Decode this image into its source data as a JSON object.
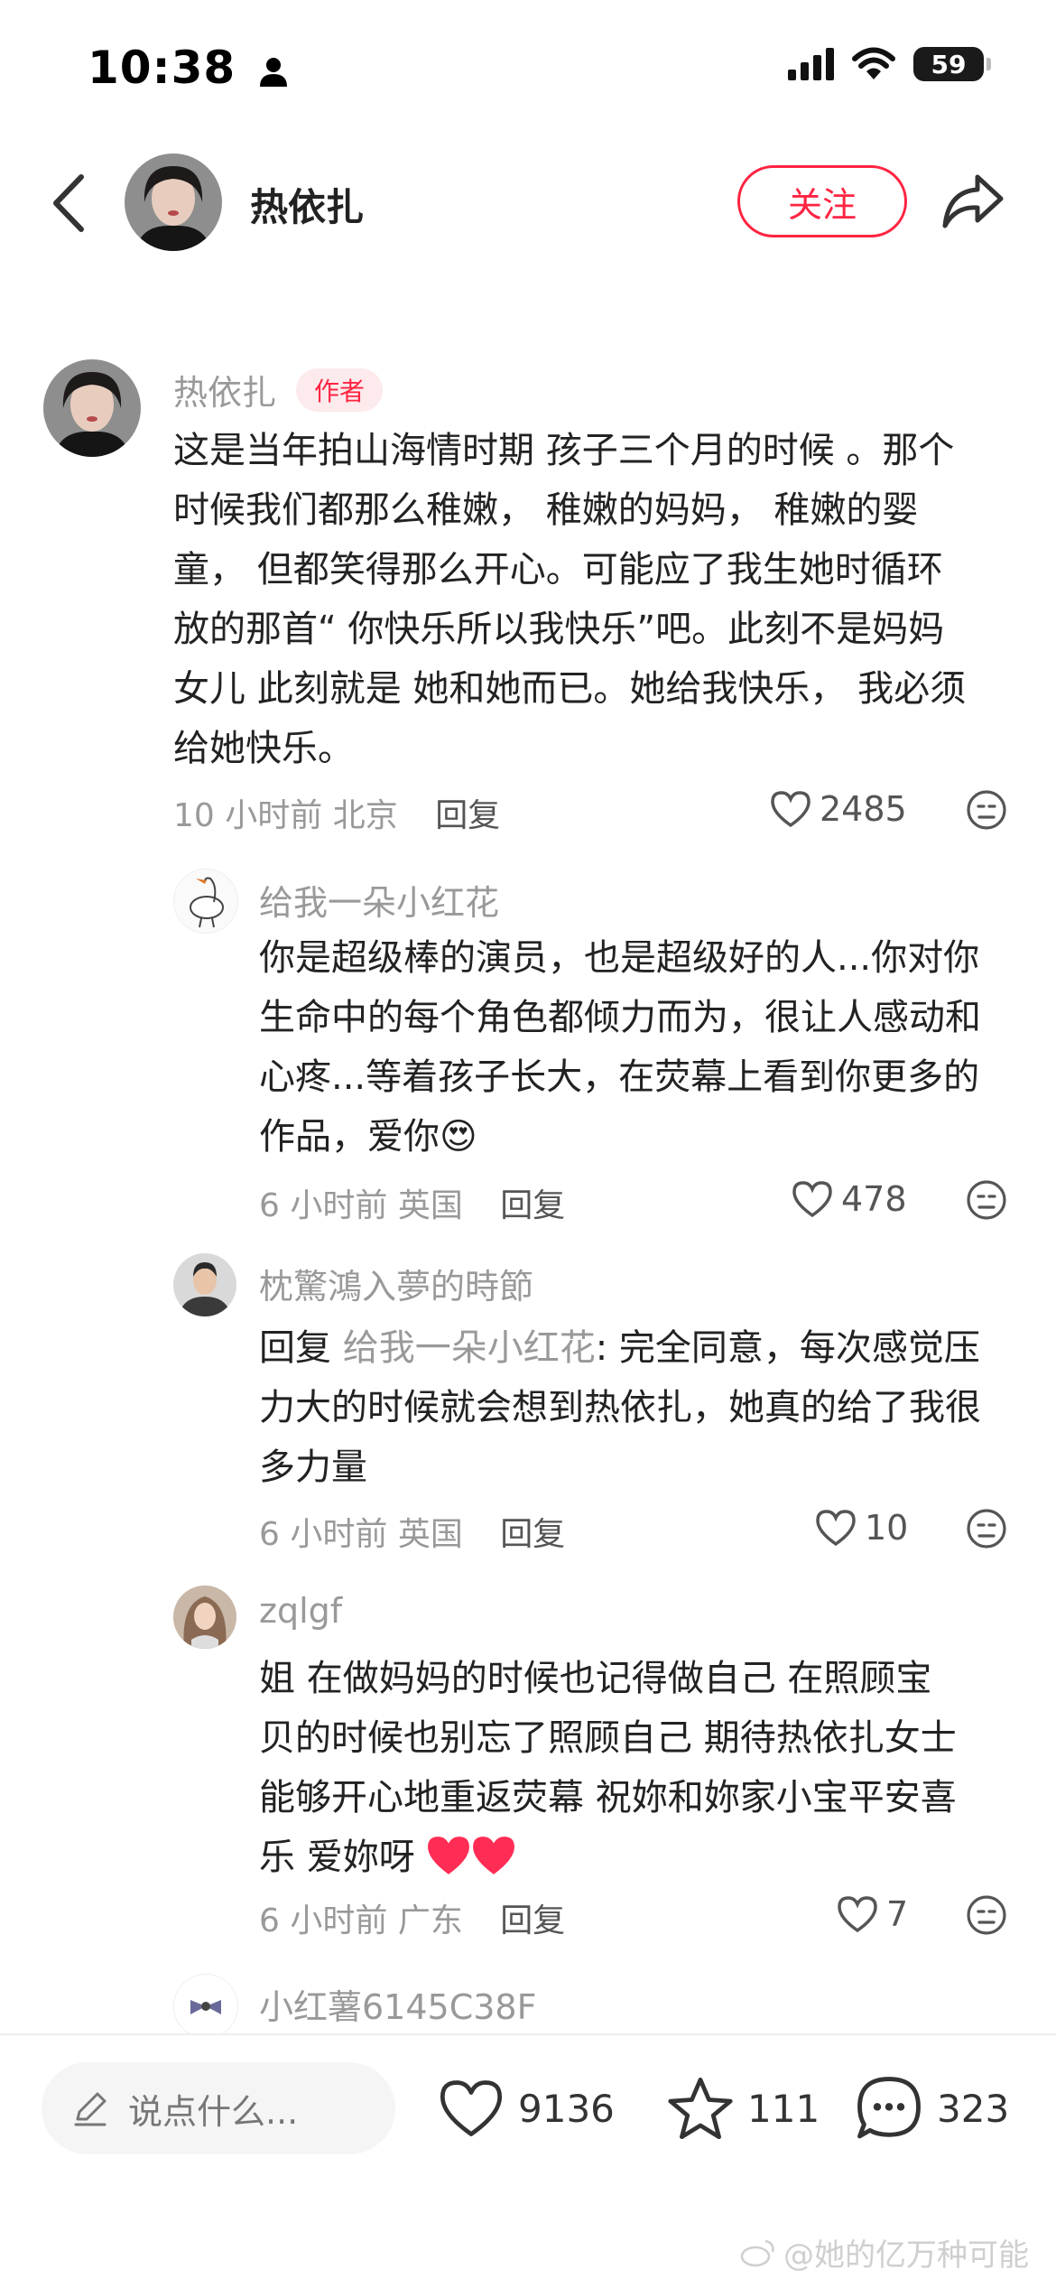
{
  "status_bar": {
    "time": "10:38",
    "battery": "59"
  },
  "header": {
    "name": "热依扎",
    "follow_label": "关注"
  },
  "colors": {
    "accent": "#ff2442",
    "muted_text": "#999999"
  },
  "comments": [
    {
      "username": "热依扎",
      "badge": "作者",
      "lines": [
        "这是当年拍山海情时期 孩子三个月的时候 。那个",
        "时候我们都那么稚嫩， 稚嫩的妈妈， 稚嫩的婴",
        "童， 但都笑得那么开心。可能应了我生她时循环",
        "放的那首“ 你快乐所以我快乐”吧。此刻不是妈妈",
        "女儿 此刻就是 她和她而已。她给我快乐， 我必须",
        "给她快乐。"
      ],
      "time": "10 小时前",
      "location": "北京",
      "reply_label": "回复",
      "likes": "2485"
    },
    {
      "username": "给我一朵小红花",
      "lines": [
        "你是超级棒的演员，也是超级好的人...你对你",
        "生命中的每个角色都倾力而为，很让人感动和",
        "心疼...等着孩子长大，在荧幕上看到你更多的",
        "作品，爱你"
      ],
      "emoji": "😍",
      "time": "6 小时前",
      "location": "英国",
      "reply_label": "回复",
      "likes": "478"
    },
    {
      "username": "枕驚鴻入夢的時節",
      "reply_prefix": "回复",
      "mention": "给我一朵小红花",
      "first_line_rest": ": 完全同意，每次感觉压",
      "lines": [
        "力大的时候就会想到热依扎，她真的给了我很",
        "多力量"
      ],
      "time": "6 小时前",
      "location": "英国",
      "reply_label": "回复",
      "likes": "10"
    },
    {
      "username": "zqlgf",
      "lines": [
        "姐  在做妈妈的时候也记得做自己  在照顾宝",
        "贝的时候也别忘了照顾自己  期待热依扎女士",
        "能够开心地重返荧幕  祝妳和妳家小宝平安喜",
        "乐  爱妳呀"
      ],
      "time": "6 小时前",
      "location": "广东",
      "reply_label": "回复",
      "likes": "7"
    },
    {
      "username": "小红薯6145C38F"
    }
  ],
  "bottom_bar": {
    "input_placeholder": "说点什么...",
    "likes": "9136",
    "favorites": "111",
    "comments": "323"
  },
  "watermark": "@她的亿万种可能"
}
